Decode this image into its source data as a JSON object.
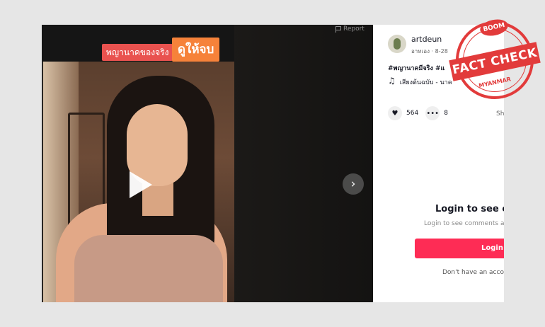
{
  "video": {
    "caption_red": "พญานาคของจริง",
    "caption_orange": "ดูให้จบ",
    "report_label": "Report"
  },
  "author": {
    "name": "artdeun",
    "meta": "อาทเอง · 8-28"
  },
  "post": {
    "hashtags": "#พญานาคมีจริง #แ",
    "music": "เสียงต้นฉบับ - นาค"
  },
  "actions": {
    "likes": "564",
    "comments": "8",
    "share": "Sh"
  },
  "login": {
    "title": "Login to see c",
    "subtitle": "Login to see comments a",
    "button": "Login",
    "signup": "Don't have an acco"
  },
  "stamp": {
    "top": "BOOM",
    "banner": "FACT CHECK",
    "bottom": "MYANMAR"
  }
}
